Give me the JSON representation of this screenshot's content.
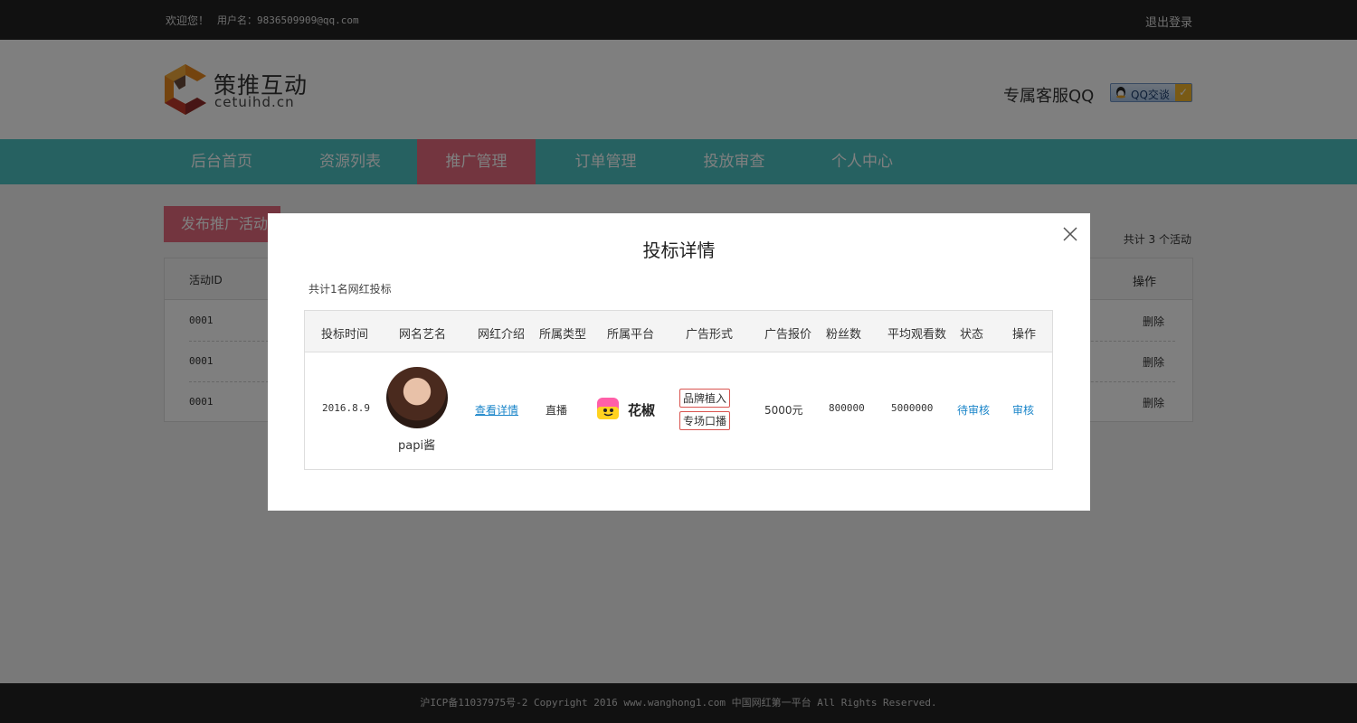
{
  "topbar": {
    "welcome": "欢迎您！",
    "username": "用户名：9836509909@qq.com",
    "logout": "退出登录"
  },
  "header": {
    "brand_cn": "策推互动",
    "brand_en": "cetuihd.cn",
    "service_label": "专属客服QQ",
    "qq_button": "QQ交谈"
  },
  "nav": {
    "items": [
      {
        "label": "后台首页"
      },
      {
        "label": "资源列表"
      },
      {
        "label": "推广管理"
      },
      {
        "label": "订单管理"
      },
      {
        "label": "投放审查"
      },
      {
        "label": "个人中心"
      }
    ],
    "active_index": 2
  },
  "main": {
    "publish_button": "发布推广活动",
    "total_text": "共计 3 个活动",
    "table": {
      "col_id": "活动ID",
      "col_op": "操作",
      "rows": [
        {
          "id": "0001",
          "op": "删除"
        },
        {
          "id": "0001",
          "op": "删除"
        },
        {
          "id": "0001",
          "op": "删除"
        }
      ]
    }
  },
  "modal": {
    "title": "投标详情",
    "count_text": "共计1名网红投标",
    "headers": [
      "投标时间",
      "网名艺名",
      "网红介绍",
      "所属类型",
      "所属平台",
      "广告形式",
      "广告报价",
      "粉丝数",
      "平均观看数",
      "状态",
      "操作"
    ],
    "row": {
      "time": "2016.8.9",
      "name": "papi酱",
      "intro_link": "查看详情",
      "type": "直播",
      "platform": "花椒",
      "ad_forms": [
        "品牌植入",
        "专场口播"
      ],
      "price": "5000元",
      "fans": "800000",
      "avg_views": "5000000",
      "status": "待审核",
      "action": "审核"
    }
  },
  "footer": {
    "text": "沪ICP备11037975号-2 Copyright 2016 www.wanghong1.com 中国网红第一平台 All Rights Reserved."
  },
  "colors": {
    "nav_bg": "#4dc3c2",
    "accent_pink": "#e66b7f",
    "dark_bar": "#222222",
    "link_blue": "#1a85c9"
  }
}
